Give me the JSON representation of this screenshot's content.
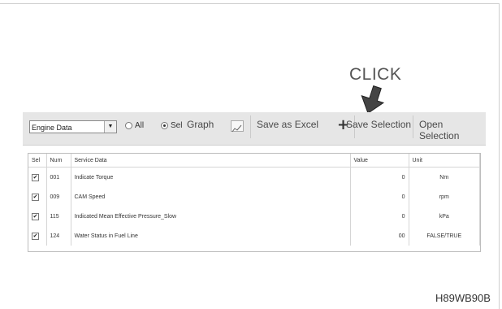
{
  "annotation": {
    "click": "CLICK",
    "reference": "H89WB90B"
  },
  "toolbar": {
    "combo_value": "Engine Data",
    "radio_all": "All",
    "radio_sel": "Sel",
    "selected_radio": "Sel",
    "graph_label": "Graph",
    "save_excel_label": "Save as Excel",
    "save_selection_label": "Save Selection",
    "open_selection_label": "Open Selection"
  },
  "table": {
    "headers": [
      "Sel",
      "Num",
      "Service Data",
      "Value",
      "Unit"
    ],
    "rows": [
      {
        "sel": "✔",
        "num": "001",
        "service": "Indicate Torque",
        "value": "0",
        "unit": "Nm"
      },
      {
        "sel": "✔",
        "num": "009",
        "service": "CAM Speed",
        "value": "0",
        "unit": "rpm"
      },
      {
        "sel": "✔",
        "num": "115",
        "service": "Indicated Mean Effective Pressure_Slow",
        "value": "0",
        "unit": "kPa"
      },
      {
        "sel": "✔",
        "num": "124",
        "service": "Water Status in Fuel Line",
        "value": "00",
        "unit": "FALSE/TRUE"
      }
    ]
  }
}
